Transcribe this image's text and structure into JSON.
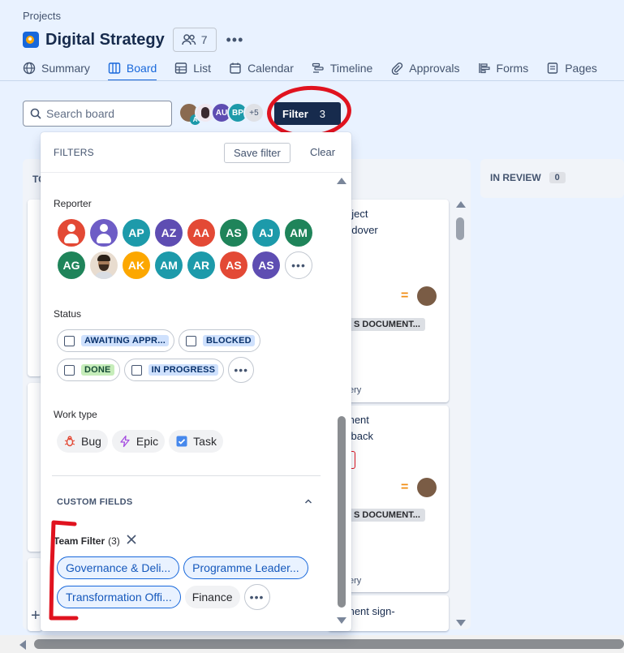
{
  "breadcrumb": "Projects",
  "project": {
    "title": "Digital Strategy",
    "people_count": "7"
  },
  "tabs": [
    {
      "label": "Summary"
    },
    {
      "label": "Board"
    },
    {
      "label": "List"
    },
    {
      "label": "Calendar"
    },
    {
      "label": "Timeline"
    },
    {
      "label": "Approvals"
    },
    {
      "label": "Forms"
    },
    {
      "label": "Pages"
    }
  ],
  "toolbar": {
    "search_placeholder": "Search board",
    "avatar_badge": "A",
    "avatars": [
      "AU",
      "BP"
    ],
    "avatars_more": "+5",
    "filter_label": "Filter",
    "filter_count": "3"
  },
  "board": {
    "todo_head": "TO",
    "review_head": "IN REVIEW",
    "review_count": "0",
    "cards": [
      {
        "line1": "oject",
        "line2": "ndover",
        "tag": "S DOCUMENT...",
        "meta": "ery"
      },
      {
        "line1": "ment",
        "line2": "yback",
        "tag": "S DOCUMENT...",
        "meta": "ery"
      },
      {
        "line1": "ment sign-",
        "line2": "",
        "tag": "",
        "meta": ""
      }
    ],
    "prio_symbol": "=",
    "add_symbol": "+"
  },
  "filters": {
    "title": "FILTERS",
    "save_label": "Save filter",
    "clear_label": "Clear",
    "reporter_label": "Reporter",
    "reporters_row1": [
      {
        "initials": "",
        "color": "#e34935",
        "kind": "person"
      },
      {
        "initials": "",
        "color": "#6e5dc6",
        "kind": "person"
      },
      {
        "initials": "AP",
        "color": "#1d9aaa",
        "kind": "initials"
      },
      {
        "initials": "AZ",
        "color": "#5e4db2",
        "kind": "initials"
      },
      {
        "initials": "AA",
        "color": "#e34935",
        "kind": "initials"
      },
      {
        "initials": "AS",
        "color": "#1f845a",
        "kind": "initials"
      },
      {
        "initials": "AJ",
        "color": "#1d9aaa",
        "kind": "initials"
      },
      {
        "initials": "AM",
        "color": "#1f845a",
        "kind": "initials"
      }
    ],
    "reporters_row2": [
      {
        "initials": "AG",
        "color": "#1f845a",
        "kind": "initials"
      },
      {
        "initials": "",
        "color": "#e8dccf",
        "kind": "photo"
      },
      {
        "initials": "AK",
        "color": "#fca700",
        "kind": "initials"
      },
      {
        "initials": "AM",
        "color": "#1d9aaa",
        "kind": "initials"
      },
      {
        "initials": "AR",
        "color": "#1d9aaa",
        "kind": "initials"
      },
      {
        "initials": "AS",
        "color": "#e34935",
        "kind": "initials"
      },
      {
        "initials": "AS",
        "color": "#5e4db2",
        "kind": "initials"
      }
    ],
    "more_symbol": "•••",
    "status_label": "Status",
    "statuses": [
      {
        "label": "AWAITING APPR...",
        "style": "blue"
      },
      {
        "label": "BLOCKED",
        "style": "blue"
      },
      {
        "label": "DONE",
        "style": "green"
      },
      {
        "label": "IN PROGRESS",
        "style": "blue"
      }
    ],
    "worktype_label": "Work type",
    "worktypes": [
      {
        "label": "Bug"
      },
      {
        "label": "Epic"
      },
      {
        "label": "Task"
      }
    ],
    "custom_fields_label": "CUSTOM FIELDS",
    "team_filter_label": "Team Filter",
    "team_filter_count": "(3)",
    "teams_selected": [
      "Governance & Deli...",
      "Programme Leader...",
      "Transformation Offi..."
    ],
    "teams_other": [
      "Finance"
    ]
  },
  "colors": {
    "accent": "#1868db",
    "annotation": "#e0131f",
    "filter_button": "#172b4d"
  }
}
